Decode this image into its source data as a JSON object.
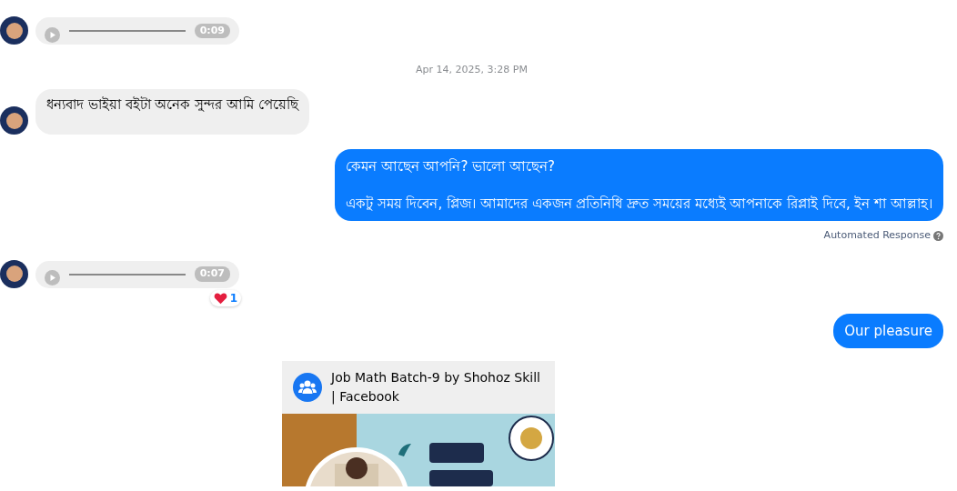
{
  "messages": [
    {
      "kind": "audio_in",
      "avatar": true,
      "duration": "0:09"
    },
    {
      "kind": "timestamp",
      "text": "Apr 14, 2025, 3:28 PM"
    },
    {
      "kind": "text_in",
      "avatar": true,
      "paragraphs": [
        "ধন্যবাদ ভাইয়া বইটা অনেক সুন্দর আমি পেয়েছি"
      ]
    },
    {
      "kind": "text_out",
      "paragraphs": [
        "কেমন আছেন আপনি? ভালো আছেন?",
        "একটু সময় দিবেন, প্লিজ। আমাদের একজন প্রতিনিধি দ্রুত সময়ের মধ্যেই আপনাকে রিপ্লাই দিবে, ইন শা আল্লাহ।"
      ],
      "note": "Automated Response"
    },
    {
      "kind": "audio_in",
      "avatar": true,
      "duration": "0:07",
      "reaction_count": "1"
    },
    {
      "kind": "text_out",
      "paragraphs": [
        "Our pleasure"
      ]
    },
    {
      "kind": "link_out",
      "title": "Job Math Batch-9 by Shohoz Skill | Facebook"
    }
  ]
}
